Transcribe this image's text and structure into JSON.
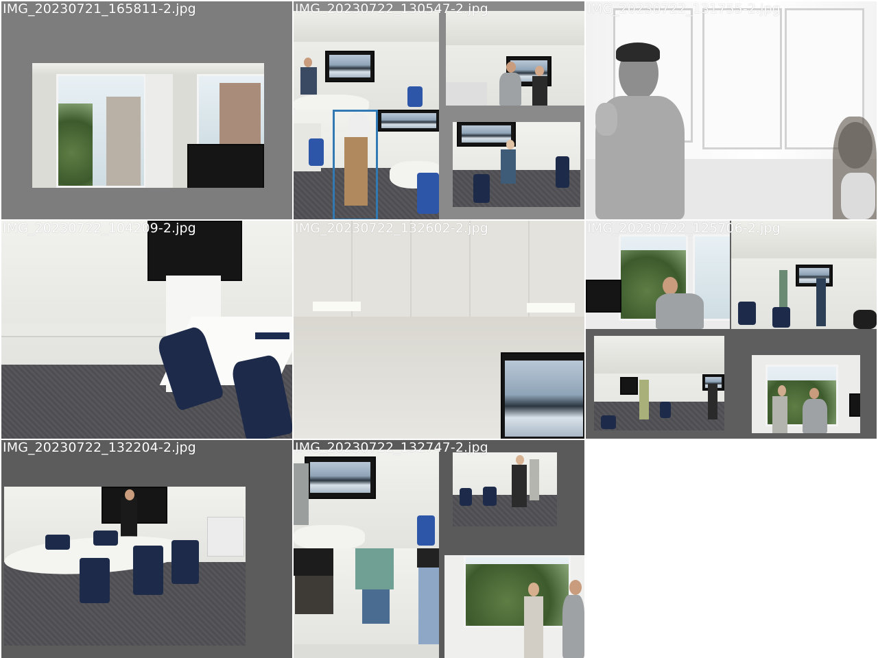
{
  "tiles": [
    {
      "caption": "IMG_20230721_165811-2.jpg"
    },
    {
      "caption": "IMG_20230722_130547-2.jpg"
    },
    {
      "caption": "IMG_20230722_131755-2.jpg"
    },
    {
      "caption": "IMG_20230722_104209-2.jpg"
    },
    {
      "caption": "IMG_20230722_132602-2.jpg"
    },
    {
      "caption": "IMG_20230722_125706-2.jpg"
    },
    {
      "caption": "IMG_20230722_132204-2.jpg"
    },
    {
      "caption": "IMG_20230722_132747-2.jpg"
    }
  ],
  "detection": {
    "label": "0",
    "color": "#2f7ab5"
  },
  "colors": {
    "background": "#ffffff",
    "padding_gray": "#7d7d7d",
    "padding_dark": "#5a5a5a"
  }
}
